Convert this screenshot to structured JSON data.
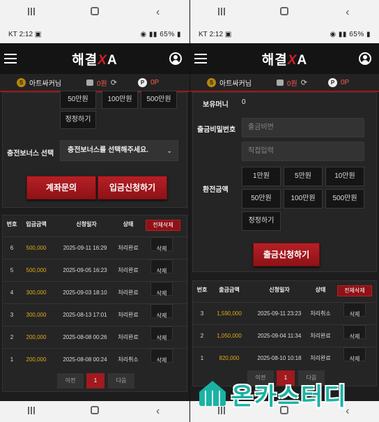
{
  "colors": {
    "accent": "#a01a1f",
    "amount": "#e2a91a",
    "background": "#1d1d1d",
    "watermark": "#19b3a4"
  },
  "left": {
    "status": {
      "carrier": "KT",
      "time": "2:12",
      "battery": "65%"
    },
    "header": {
      "logo_main": "해결",
      "logo_x": "X",
      "logo_end": "A"
    },
    "info": {
      "coin_letter": "S",
      "nickname": "아트싸커님",
      "balance": "0원",
      "point_letter": "P",
      "points": "0P"
    },
    "amount_buttons": [
      "50만원",
      "100만원",
      "500만원"
    ],
    "reset_label": "정정하기",
    "bonus_label": "충전보너스 선택",
    "bonus_placeholder": "충전보너스를 선택해주세요.",
    "inquiry_button": "계좌문의",
    "submit_button": "입금신청하기",
    "table": {
      "headers": [
        "번호",
        "입금금액",
        "신청일자",
        "상태"
      ],
      "delete_all": "전체삭제",
      "delete_label": "삭제",
      "rows": [
        {
          "no": "6",
          "amount": "500,000",
          "date": "2025-09-11 16:29",
          "status": "처리완료"
        },
        {
          "no": "5",
          "amount": "500,000",
          "date": "2025-09-05 16:23",
          "status": "처리완료"
        },
        {
          "no": "4",
          "amount": "300,000",
          "date": "2025-09-03 18:10",
          "status": "처리완료"
        },
        {
          "no": "3",
          "amount": "300,000",
          "date": "2025-08-13 17:01",
          "status": "처리완료"
        },
        {
          "no": "2",
          "amount": "200,000",
          "date": "2025-08-08 00:26",
          "status": "처리완료"
        },
        {
          "no": "1",
          "amount": "200,000",
          "date": "2025-08-08 00:24",
          "status": "처리취소"
        }
      ]
    },
    "pager": {
      "prev": "이전",
      "page": "1",
      "next": "다음"
    }
  },
  "right": {
    "status": {
      "carrier": "KT",
      "time": "2:12",
      "battery": "65%"
    },
    "header": {
      "logo_main": "해결",
      "logo_x": "X",
      "logo_end": "A"
    },
    "info": {
      "coin_letter": "S",
      "nickname": "아트싸커님",
      "balance": "0원",
      "point_letter": "P",
      "points": "0P"
    },
    "holding_label": "보유머니",
    "holding_value": "0",
    "password_label": "출금비밀번호",
    "password_placeholder": "출금비번",
    "direct_placeholder": "직접입력",
    "exchange_label": "환전금액",
    "amount_buttons": [
      "1만원",
      "5만원",
      "10만원",
      "50만원",
      "100만원",
      "500만원"
    ],
    "reset_label": "정정하기",
    "submit_button": "출금신청하기",
    "table": {
      "headers": [
        "번호",
        "출금금액",
        "신청일자",
        "상태"
      ],
      "delete_all": "전체삭제",
      "delete_label": "삭제",
      "rows": [
        {
          "no": "3",
          "amount": "1,590,000",
          "date": "2025-09-11 23:23",
          "status": "처리취소"
        },
        {
          "no": "2",
          "amount": "1,050,000",
          "date": "2025-09-04 11:34",
          "status": "처리완료"
        },
        {
          "no": "1",
          "amount": "820,000",
          "date": "2025-08-10 10:18",
          "status": "처리완료"
        }
      ]
    },
    "pager": {
      "prev": "이전",
      "page": "1",
      "next": "다음"
    }
  },
  "watermark": "온카스터디"
}
